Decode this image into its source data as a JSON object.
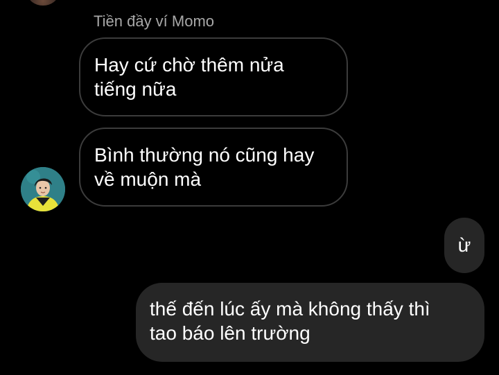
{
  "chat": {
    "sender_name": "Tiền đầy ví Momo",
    "incoming_messages": [
      {
        "lines": [
          "Hay cứ chờ thêm nửa",
          "tiếng nữa"
        ]
      },
      {
        "lines": [
          "Bình thường nó cũng hay",
          "về muộn mà"
        ]
      }
    ],
    "outgoing_messages": [
      {
        "lines": [
          "ừ"
        ]
      },
      {
        "lines": [
          "thế đến lúc ấy mà không thấy thì",
          "tao báo lên trường"
        ]
      }
    ]
  },
  "colors": {
    "background": "#000000",
    "incoming_bubble_border": "#3c3c3c",
    "outgoing_bubble_fill": "#262626",
    "sender_name_text": "#a8a8a8",
    "message_text": "#ffffff"
  },
  "icons": {
    "sender_avatar": "user-avatar-photo",
    "previous_avatar": "user-avatar-photo"
  }
}
